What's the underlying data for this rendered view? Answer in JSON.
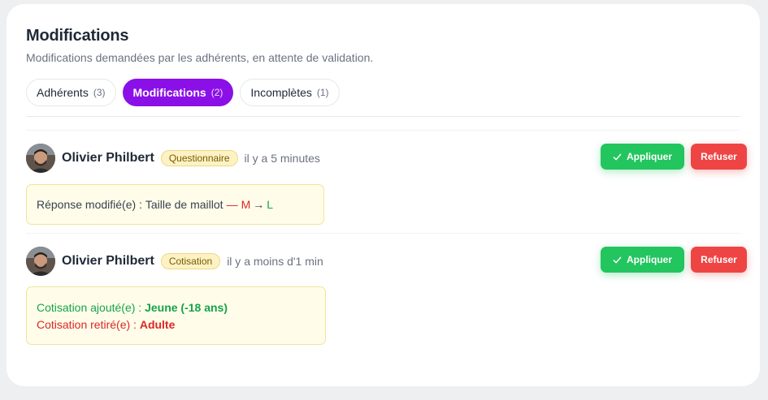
{
  "header": {
    "title": "Modifications",
    "subtitle": "Modifications demandées par les adhérents, en attente de validation."
  },
  "tabs": [
    {
      "label": "Adhérents",
      "count": "(3)",
      "active": false
    },
    {
      "label": "Modifications",
      "count": "(2)",
      "active": true
    },
    {
      "label": "Incomplètes",
      "count": "(1)",
      "active": false
    }
  ],
  "requests": [
    {
      "name": "Olivier Philbert",
      "badge": "Questionnaire",
      "time": "il y a 5 minutes",
      "change": {
        "prefix": "Réponse modifié(e) : ",
        "field": "Taille de maillot",
        "dash": "—",
        "old_value": "M",
        "arrow": "→",
        "new_value": "L"
      },
      "apply_label": "Appliquer",
      "refuse_label": "Refuser"
    },
    {
      "name": "Olivier Philbert",
      "badge": "Cotisation",
      "time": "il y a moins d'1 min",
      "added_prefix": "Cotisation ajouté(e) : ",
      "added_value": "Jeune (-18 ans)",
      "removed_prefix": "Cotisation retiré(e) : ",
      "removed_value": "Adulte",
      "apply_label": "Appliquer",
      "refuse_label": "Refuser"
    }
  ],
  "colors": {
    "accent": "#8b10e8",
    "apply": "#22c55e",
    "refuse": "#ef4444",
    "badge_bg": "#fdf2c4"
  }
}
